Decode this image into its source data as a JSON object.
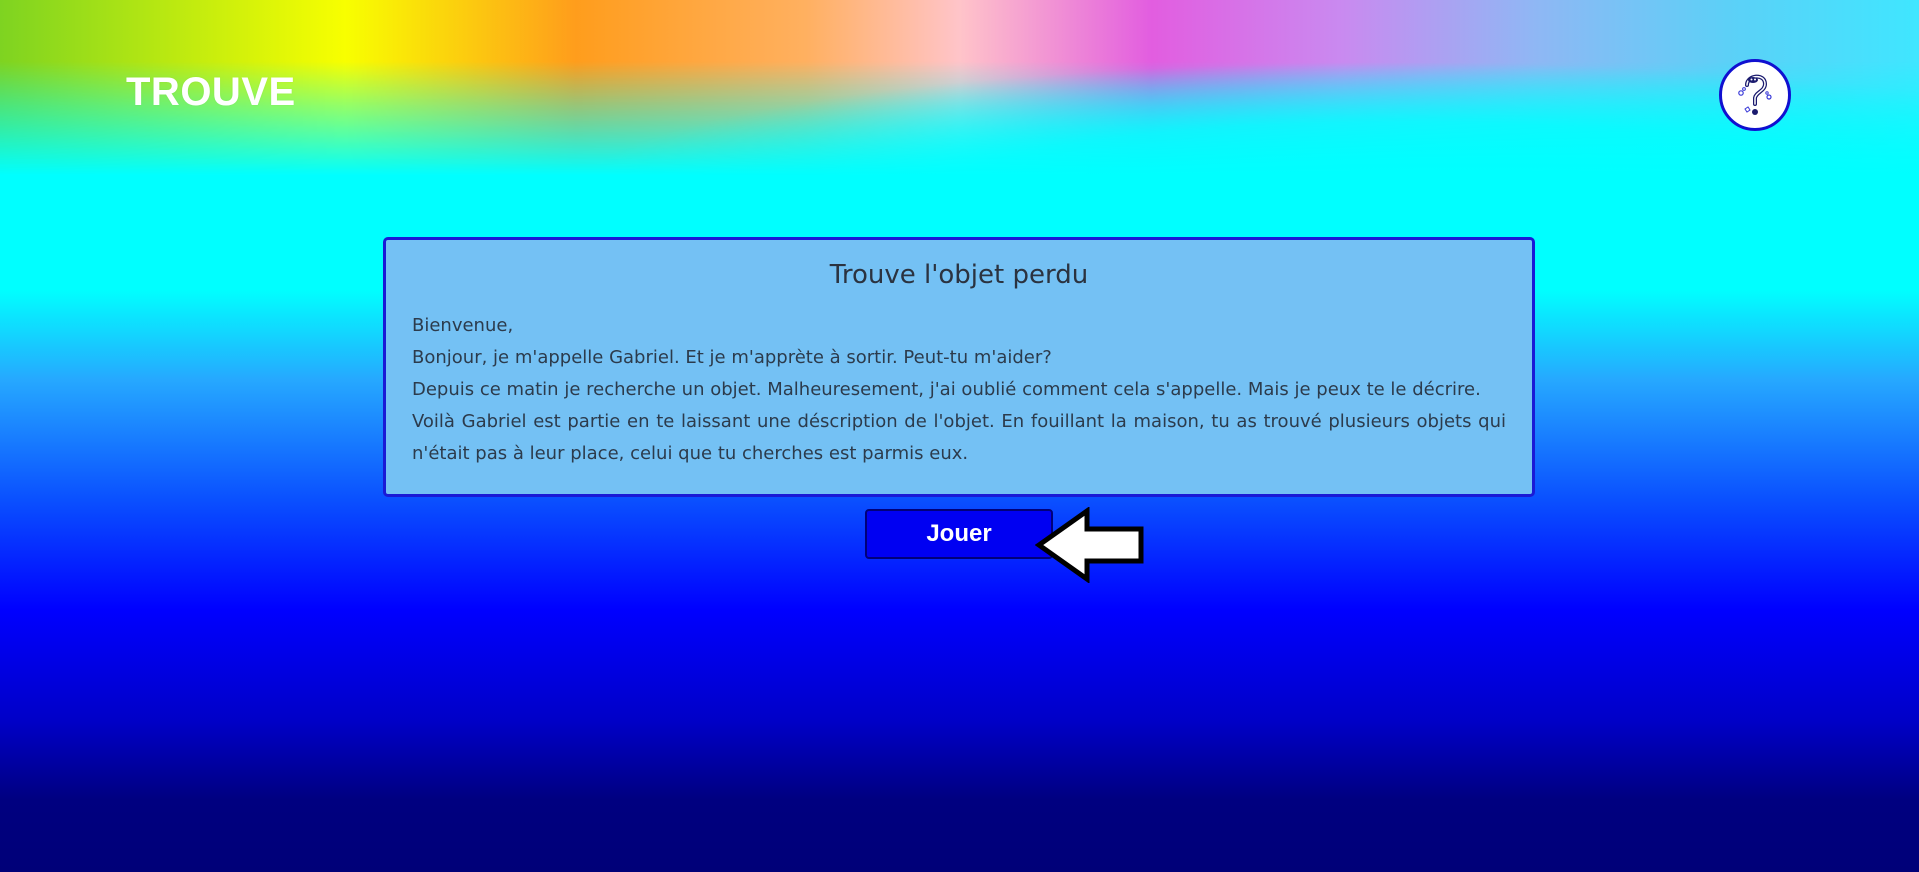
{
  "header": {
    "brand": "TROUVE",
    "help_icon": "question-mark-icon"
  },
  "panel": {
    "title": "Trouve l'objet perdu",
    "paragraphs": [
      "Bienvenue,",
      "Bonjour, je m'appelle Gabriel. Et je m'apprète à sortir. Peut-tu m'aider?",
      "Depuis ce matin je recherche un objet. Malheuresement, j'ai oublié comment cela s'appelle. Mais je peux te le décrire.",
      "Voilà Gabriel est partie en te laissant une déscription de l'objet. En fouillant la maison, tu as trouvé plusieurs objets qui n'était pas à leur place, celui que tu cherches est parmis eux."
    ]
  },
  "actions": {
    "play_label": "Jouer",
    "pointer_icon": "left-arrow-icon"
  },
  "colors": {
    "panel_bg": "#74c1f4",
    "panel_border": "#1a1ad6",
    "button_bg": "#0000f2",
    "brand_text": "#ffffff"
  }
}
